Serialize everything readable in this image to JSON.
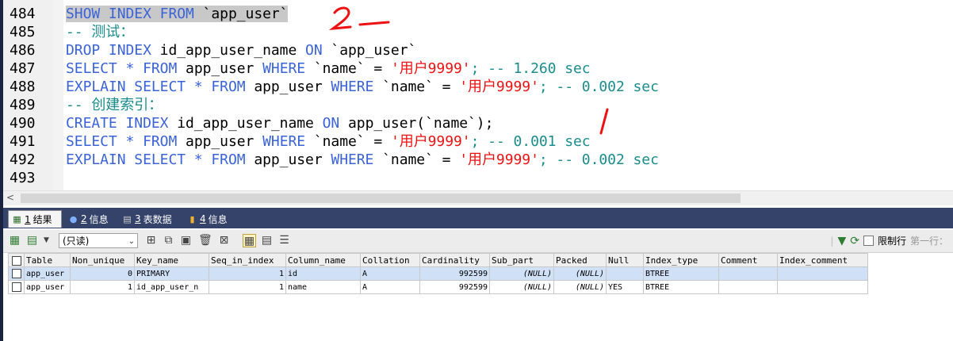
{
  "editor": {
    "lines": [
      {
        "no": "484",
        "tokens": [
          {
            "t": "SHOW INDEX FROM ",
            "c": "kw sel"
          },
          {
            "t": "`app_user`",
            "c": "id sel"
          }
        ]
      },
      {
        "no": "485",
        "tokens": [
          {
            "t": "-- 测试：",
            "c": "cmt"
          }
        ]
      },
      {
        "no": "486",
        "tokens": [
          {
            "t": "DROP INDEX ",
            "c": "kw"
          },
          {
            "t": "id_app_user_name ",
            "c": "id"
          },
          {
            "t": "ON ",
            "c": "kw"
          },
          {
            "t": "`app_user`",
            "c": "id"
          }
        ]
      },
      {
        "no": "487",
        "tokens": [
          {
            "t": "SELECT * FROM ",
            "c": "kw"
          },
          {
            "t": "app_user ",
            "c": "id"
          },
          {
            "t": "WHERE ",
            "c": "kw"
          },
          {
            "t": "`name` = ",
            "c": "id"
          },
          {
            "t": "'用户9999'",
            "c": "str"
          },
          {
            "t": "; -- 1.260 sec",
            "c": "cmt"
          }
        ]
      },
      {
        "no": "488",
        "tokens": [
          {
            "t": "EXPLAIN SELECT * FROM ",
            "c": "kw"
          },
          {
            "t": "app_user ",
            "c": "id"
          },
          {
            "t": "WHERE ",
            "c": "kw"
          },
          {
            "t": "`name` = ",
            "c": "id"
          },
          {
            "t": "'用户9999'",
            "c": "str"
          },
          {
            "t": "; -- 0.002 sec",
            "c": "cmt"
          }
        ]
      },
      {
        "no": "489",
        "tokens": [
          {
            "t": "-- 创建索引：",
            "c": "cmt"
          }
        ]
      },
      {
        "no": "490",
        "tokens": [
          {
            "t": "CREATE INDEX ",
            "c": "kw"
          },
          {
            "t": "id_app_user_name ",
            "c": "id"
          },
          {
            "t": "ON ",
            "c": "kw"
          },
          {
            "t": "app_user(`name`);",
            "c": "id"
          }
        ]
      },
      {
        "no": "491",
        "tokens": [
          {
            "t": "SELECT * FROM ",
            "c": "kw"
          },
          {
            "t": "app_user ",
            "c": "id"
          },
          {
            "t": "WHERE ",
            "c": "kw"
          },
          {
            "t": "`name` = ",
            "c": "id"
          },
          {
            "t": "'用户9999'",
            "c": "str"
          },
          {
            "t": "; -- 0.001 sec",
            "c": "cmt"
          }
        ]
      },
      {
        "no": "492",
        "tokens": [
          {
            "t": "EXPLAIN SELECT * FROM ",
            "c": "kw"
          },
          {
            "t": "app_user ",
            "c": "id"
          },
          {
            "t": "WHERE ",
            "c": "kw"
          },
          {
            "t": "`name` = ",
            "c": "id"
          },
          {
            "t": "'用户9999'",
            "c": "str"
          },
          {
            "t": "; -- 0.002 sec",
            "c": "cmt"
          }
        ]
      },
      {
        "no": "493",
        "tokens": []
      }
    ]
  },
  "tabs": [
    {
      "num": "1",
      "label": "结果",
      "icon": "result-grid-icon"
    },
    {
      "num": "2",
      "label": "信息",
      "icon": "info-icon"
    },
    {
      "num": "3",
      "label": "表数据",
      "icon": "table-data-icon"
    },
    {
      "num": "4",
      "label": "信息",
      "icon": "info-chart-icon"
    }
  ],
  "toolbar": {
    "mode_value": "(只读)",
    "limit_label": "限制行",
    "first_row_label": "第一行："
  },
  "grid": {
    "columns": [
      "Table",
      "Non_unique",
      "Key_name",
      "Seq_in_index",
      "Column_name",
      "Collation",
      "Cardinality",
      "Sub_part",
      "Packed",
      "Null",
      "Index_type",
      "Comment",
      "Index_comment"
    ],
    "rows": [
      [
        "app_user",
        "0",
        "PRIMARY",
        "1",
        "id",
        "A",
        "992599",
        "(NULL)",
        "(NULL)",
        "",
        "BTREE",
        "",
        ""
      ],
      [
        "app_user",
        "1",
        "id_app_user_n",
        "1",
        "name",
        "A",
        "992599",
        "(NULL)",
        "(NULL)",
        "YES",
        "BTREE",
        "",
        ""
      ]
    ]
  },
  "annotations": {
    "mark_2": "2",
    "mark_1": "1"
  },
  "colors": {
    "keyword": "#3b63d8",
    "string": "#ee1111",
    "comment": "#1a8c8c",
    "tabbar": "#35436b",
    "annotation": "#ee1111"
  }
}
